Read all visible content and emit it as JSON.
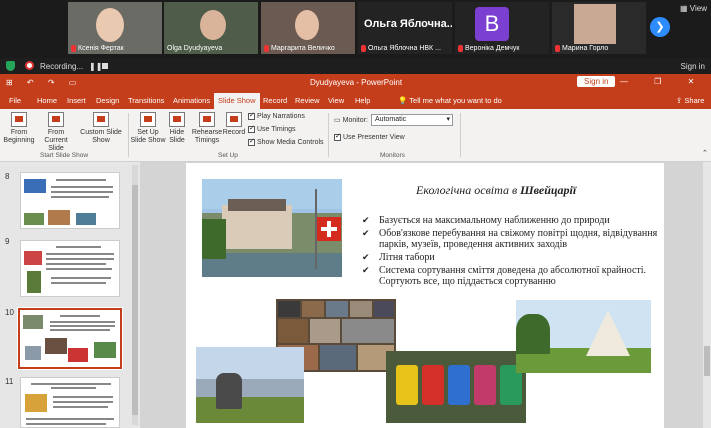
{
  "participants": [
    {
      "name": "Ксенія Фертак"
    },
    {
      "name": "Olga Dyudyayeva"
    },
    {
      "name": "Маргарита Величко"
    },
    {
      "name": "Ольга Яблочна НВК ...",
      "display": "Ольга Яблочна..."
    },
    {
      "name": "Вероніка Демчук",
      "initial": "B"
    },
    {
      "name": "Марина Горло"
    }
  ],
  "zoom": {
    "view_label": "View",
    "recording_label": "Recording...",
    "pause_label": "❚❚",
    "sign_in_label": "Sign in"
  },
  "titlebar": {
    "title": "Dyudyayeva  -  PowerPoint",
    "sign_in_button": "Sign in",
    "window_controls": "— ❐ ✕"
  },
  "tabs": [
    {
      "label": "File"
    },
    {
      "label": "Home"
    },
    {
      "label": "Insert"
    },
    {
      "label": "Design"
    },
    {
      "label": "Transitions"
    },
    {
      "label": "Animations"
    },
    {
      "label": "Slide Show"
    },
    {
      "label": "Record"
    },
    {
      "label": "Review"
    },
    {
      "label": "View"
    },
    {
      "label": "Help"
    }
  ],
  "active_tab": "Slide Show",
  "tell_me": "Tell me what you want to do",
  "share": "Share",
  "ribbon": {
    "from_beginning": "From Beginning",
    "from_current": "From Current Slide",
    "custom_show": "Custom Slide Show",
    "setup_show": "Set Up Slide Show",
    "hide_slide": "Hide Slide",
    "rehearse": "Rehearse Timings",
    "record": "Record",
    "play_narrations": "Play Narrations",
    "use_timings": "Use Timings",
    "show_media_controls": "Show Media Controls",
    "monitor_label": "Monitor:",
    "monitor_value": "Automatic",
    "use_presenter_view": "Use Presenter View",
    "group_start": "Start Slide Show",
    "group_setup": "Set Up",
    "group_monitors": "Monitors"
  },
  "thumbnails": [
    {
      "number": "8"
    },
    {
      "number": "9"
    },
    {
      "number": "10"
    },
    {
      "number": "11"
    }
  ],
  "slide": {
    "title_pre": "Екологічна освіта в ",
    "title_bold": "Швейцарії",
    "bullets": [
      "Базується на максимальному наближенню до природи",
      "Обов'язкове перебування на свіжому повітрі щодня, відвідування парків, музеїв, проведення активних заходів",
      "Літня табори",
      "Система сортування сміття доведена до абсолютної крайності. Сортують все, що піддається сортуванню"
    ]
  },
  "colors": {
    "ppt_red": "#c43e1c",
    "zoom_blue": "#2d8cff"
  }
}
